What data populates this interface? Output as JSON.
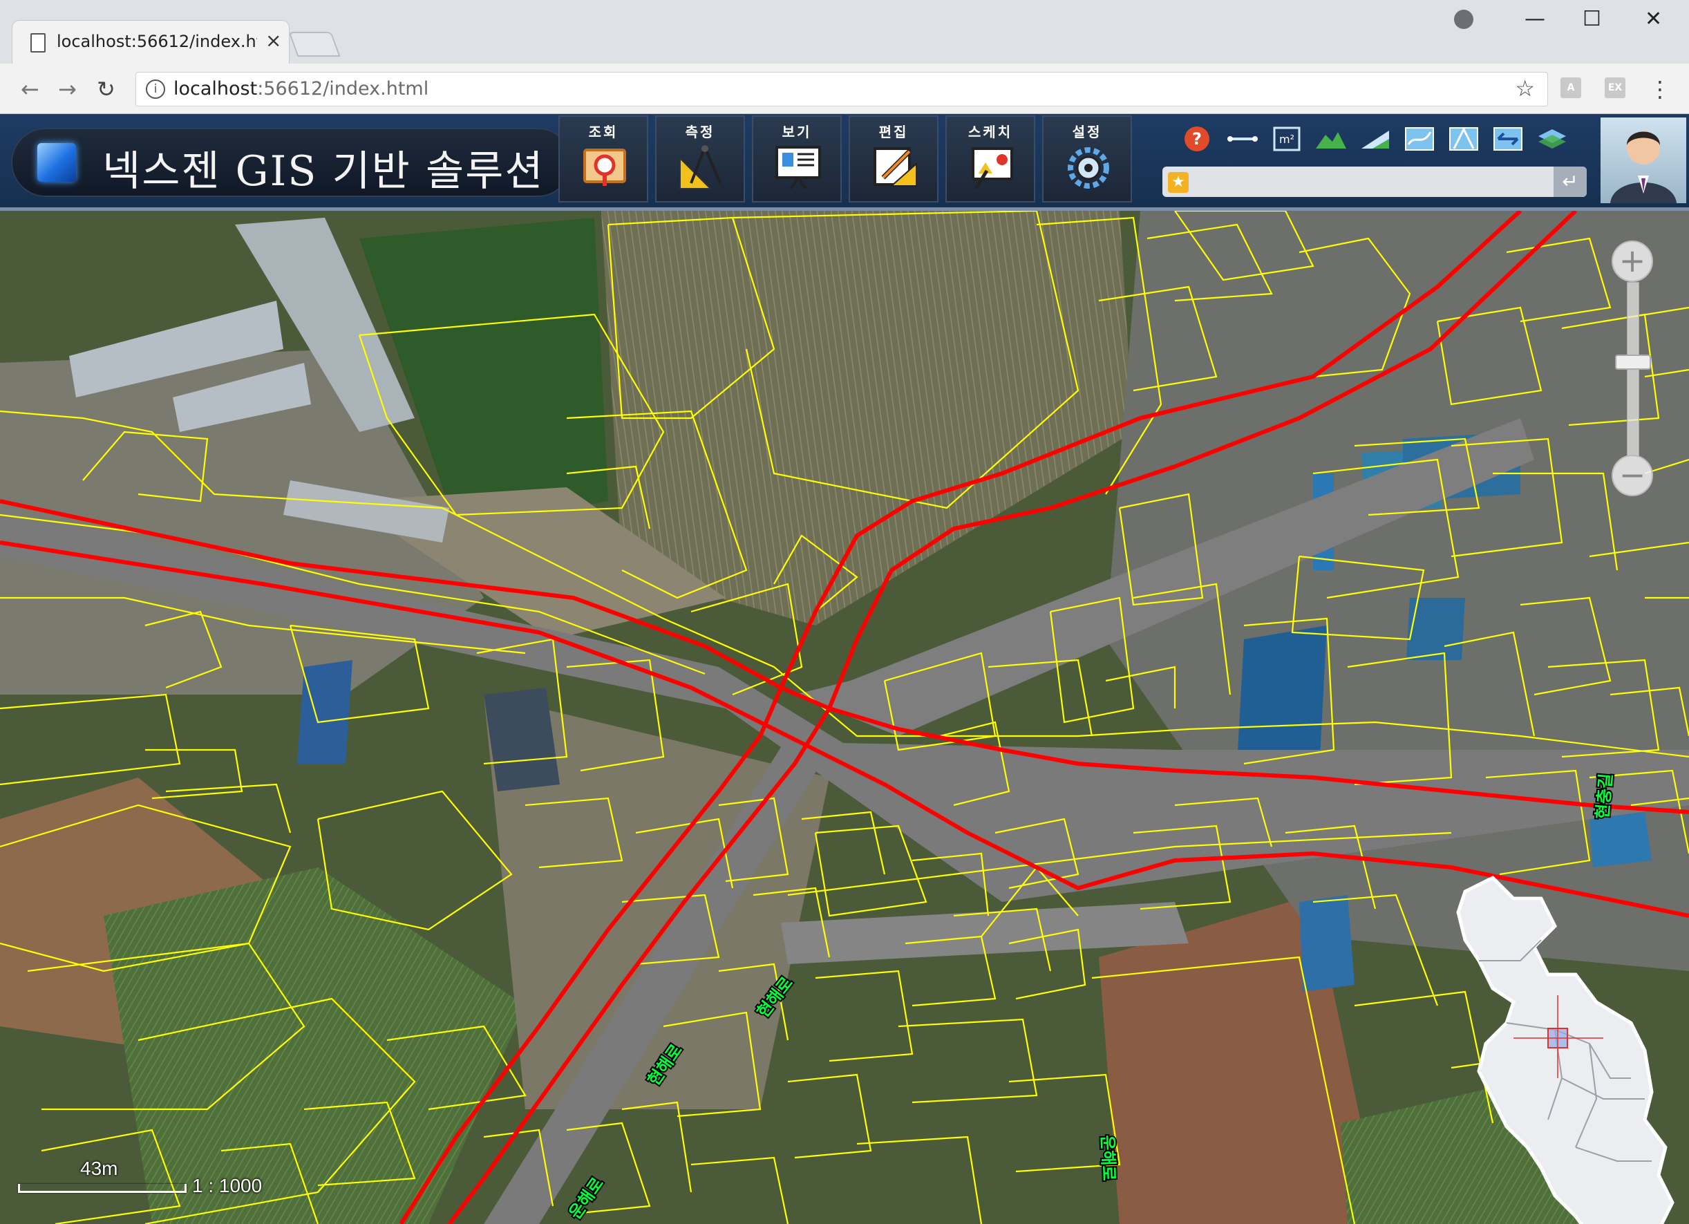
{
  "browser": {
    "tab_title": "localhost:56612/index.html",
    "tab_close": "×",
    "url_host": "localhost",
    "url_rest": ":56612/index.html",
    "info_glyph": "i",
    "star_glyph": "☆",
    "back_glyph": "←",
    "forward_glyph": "→",
    "reload_glyph": "↻",
    "menu_glyph": "⋮",
    "minimize_glyph": "—",
    "maximize_glyph": "☐",
    "close_glyph": "✕",
    "ext_icons": [
      "pdf-icon",
      "ex-icon"
    ],
    "ext_labels": [
      "A",
      "EX"
    ]
  },
  "app": {
    "title": "넥스젠 GIS 기반 솔루션",
    "menus": [
      {
        "label": "조회",
        "icon": "search-map-icon"
      },
      {
        "label": "측정",
        "icon": "ruler-compass-icon"
      },
      {
        "label": "보기",
        "icon": "presentation-board-icon"
      },
      {
        "label": "편집",
        "icon": "edit-pencil-icon"
      },
      {
        "label": "스케치",
        "icon": "sketch-board-icon"
      },
      {
        "label": "설정",
        "icon": "settings-gears-icon"
      }
    ],
    "tools": [
      "help-icon",
      "measure-distance-icon",
      "measure-area-icon",
      "terrain-profile-icon",
      "slope-icon",
      "map-layer-1-icon",
      "map-layer-2-icon",
      "swap-icon",
      "layers-icon"
    ],
    "area_unit": "m²",
    "search": {
      "value": "",
      "favorite_glyph": "★",
      "enter_glyph": "↵"
    },
    "colors": {
      "header": "#1e3b64",
      "road": "#ff0000",
      "parcel": "#ffff00",
      "label": "#00ff3c"
    }
  },
  "map": {
    "road_labels": [
      "현해로",
      "현해로",
      "운해로",
      "운해로",
      "현충길"
    ],
    "scale_distance": "43m",
    "scale_ratio": "1 : 1000",
    "zoom_in": "+",
    "zoom_out": "−",
    "zoom_level": 0.45
  }
}
